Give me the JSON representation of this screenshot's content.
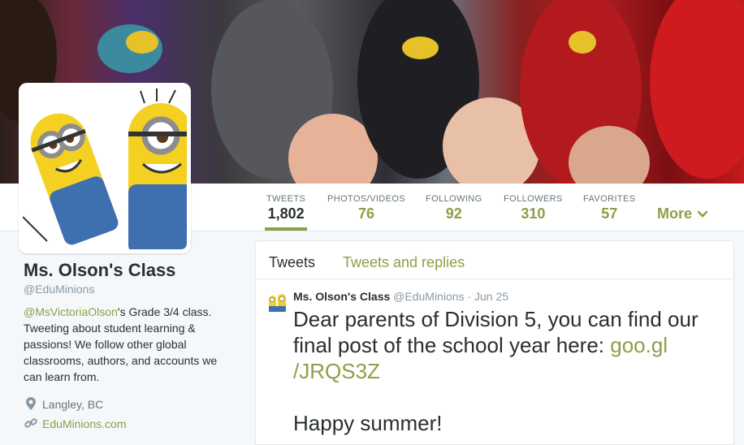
{
  "nav": {
    "stats": [
      {
        "label": "TWEETS",
        "value": "1,802"
      },
      {
        "label": "PHOTOS/VIDEOS",
        "value": "76"
      },
      {
        "label": "FOLLOWING",
        "value": "92"
      },
      {
        "label": "FOLLOWERS",
        "value": "310"
      },
      {
        "label": "FAVORITES",
        "value": "57"
      }
    ],
    "more": "More"
  },
  "profile": {
    "name": "Ms. Olson's Class",
    "handle": "@EduMinions",
    "bio_mention": "@MsVictoriaOlson",
    "bio_text": "'s Grade 3/4 class. Tweeting about student learning & passions! We follow other global classrooms, authors, and accounts we can learn from.",
    "location": "Langley, BC",
    "website": "EduMinions.com"
  },
  "timeline": {
    "tabs": [
      "Tweets",
      "Tweets and replies"
    ],
    "tweet": {
      "name": "Ms. Olson's Class",
      "handle": "@EduMinions",
      "dot": "·",
      "date": "Jun 25",
      "text_before": "Dear parents of Division 5, you can find our final post of the school year here: ",
      "link": "goo.gl /JRQS3Z",
      "text_after": "Happy summer!"
    }
  },
  "colors": {
    "accent": "#8ba046",
    "text": "#292f33",
    "muted": "#8899a6"
  },
  "icons": {
    "location": "map-pin-icon",
    "website": "link-icon",
    "more": "chevron-down-icon"
  }
}
